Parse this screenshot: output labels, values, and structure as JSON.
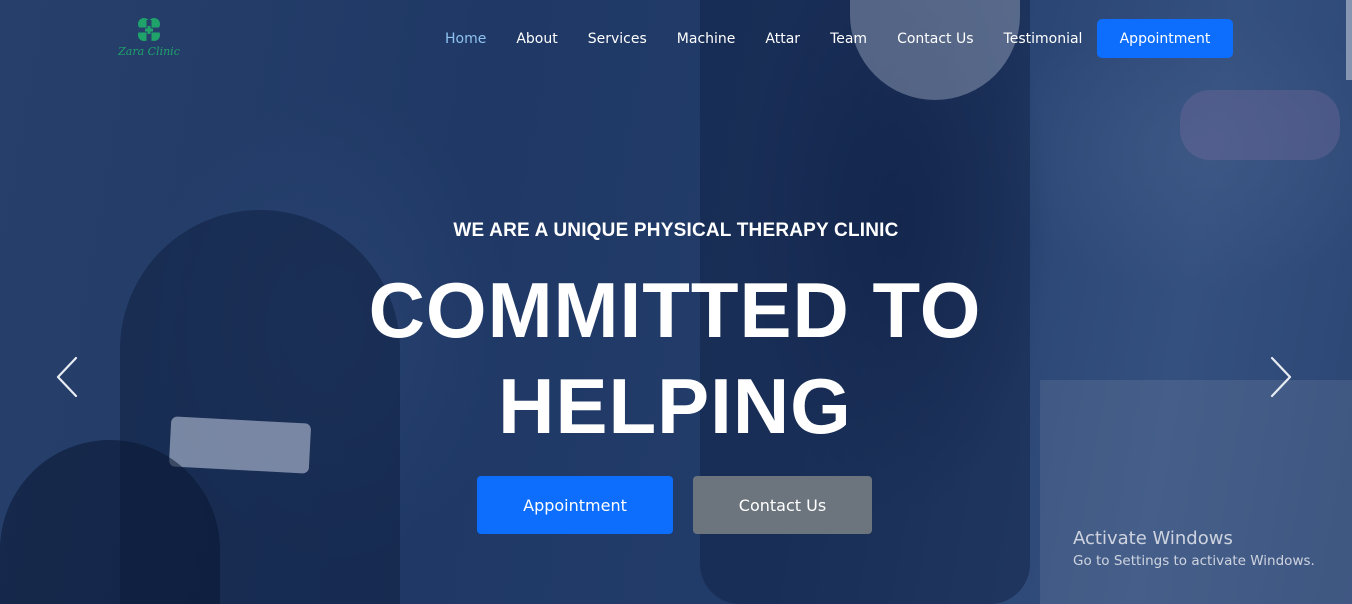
{
  "brand": {
    "name": "Zara Clinic",
    "logo_color": "#1fa36b"
  },
  "nav": {
    "items": [
      {
        "label": "Home",
        "active": true
      },
      {
        "label": "About"
      },
      {
        "label": "Services"
      },
      {
        "label": "Machine"
      },
      {
        "label": "Attar"
      },
      {
        "label": "Team"
      },
      {
        "label": "Contact Us"
      },
      {
        "label": "Testimonial"
      }
    ],
    "appointment_label": "Appointment"
  },
  "hero": {
    "subtitle": "WE ARE A UNIQUE PHYSICAL THERAPY CLINIC",
    "headline_line1": "COMMITTED TO",
    "headline_line2": "HELPING",
    "primary_button": "Appointment",
    "secondary_button": "Contact Us",
    "prev_icon": "chevron-left-icon",
    "next_icon": "chevron-right-icon"
  },
  "watermark": {
    "title": "Activate Windows",
    "subtitle": "Go to Settings to activate Windows."
  },
  "colors": {
    "primary": "#0d6efd",
    "secondary": "#6c757d",
    "active_nav": "#8fc2f0"
  }
}
